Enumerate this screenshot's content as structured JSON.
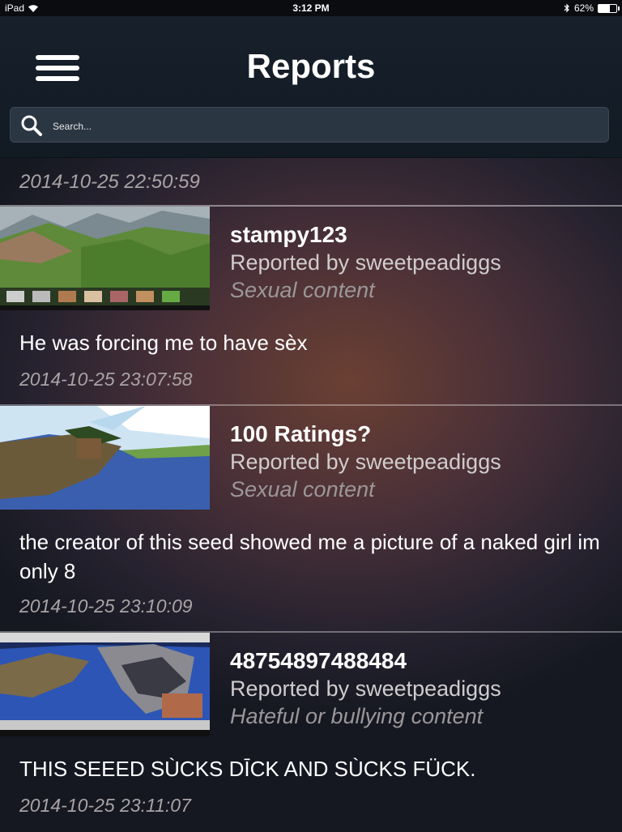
{
  "status_bar": {
    "device": "iPad",
    "time": "3:12 PM",
    "battery_percent": "62%",
    "battery_level": 0.62
  },
  "header": {
    "title": "Reports"
  },
  "search": {
    "placeholder": "Search..."
  },
  "top_timestamp": "2014-10-25 22:50:59",
  "reports": [
    {
      "title": "stampy123",
      "reporter": "Reported by sweetpeadiggs",
      "reason": "Sexual content",
      "message": "He was forcing me to have sèx",
      "timestamp": "2014-10-25 23:07:58"
    },
    {
      "title": "100 Ratings?",
      "reporter": "Reported by sweetpeadiggs",
      "reason": "Sexual content",
      "message": "the creator of this seed showed me a picture of a naked girl im only 8",
      "timestamp": "2014-10-25 23:10:09"
    },
    {
      "title": "48754897488484",
      "reporter": "Reported by sweetpeadiggs",
      "reason": "Hateful or bullying content",
      "message": "THIS SEEED SÙCKS DĪCK AND SÙCKS FÜCK.",
      "timestamp": "2014-10-25 23:11:07"
    }
  ]
}
